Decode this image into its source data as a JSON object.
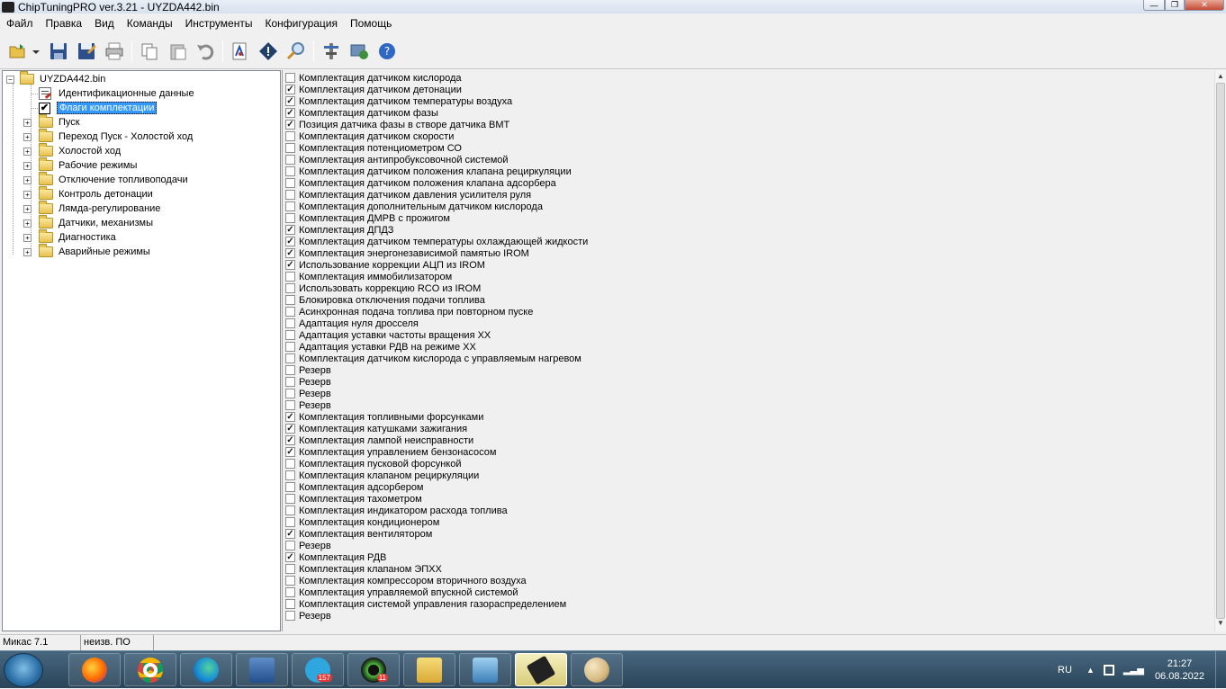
{
  "window": {
    "title": "ChipTuningPRO ver.3.21 - UYZDA442.bin",
    "controls": {
      "minimize": "—",
      "maximize": "❐",
      "close": "✕"
    }
  },
  "menu": [
    "Файл",
    "Правка",
    "Вид",
    "Команды",
    "Инструменты",
    "Конфигурация",
    "Помощь"
  ],
  "toolbar": [
    "open-icon",
    "dropdown-arrow-icon",
    "save-icon",
    "save-as-icon",
    "print-icon",
    "copy-icon",
    "paste-icon",
    "undo-icon",
    "compare-icon",
    "diamond-info-icon",
    "search-icon",
    "tools-icon",
    "checksum-icon",
    "help-icon"
  ],
  "tree": {
    "root": "UYZDA442.bin",
    "children": [
      {
        "label": "Идентификационные данные",
        "icon": "doc-icon",
        "expandable": false,
        "selected": false
      },
      {
        "label": "Флаги комплектации",
        "icon": "checkbox-icon",
        "expandable": false,
        "selected": true
      },
      {
        "label": "Пуск",
        "icon": "folder-icon",
        "expandable": true
      },
      {
        "label": "Переход Пуск - Холостой ход",
        "icon": "folder-icon",
        "expandable": true
      },
      {
        "label": "Холостой ход",
        "icon": "folder-icon",
        "expandable": true
      },
      {
        "label": "Рабочие режимы",
        "icon": "folder-icon",
        "expandable": true
      },
      {
        "label": "Отключение топливоподачи",
        "icon": "folder-icon",
        "expandable": true
      },
      {
        "label": "Контроль детонации",
        "icon": "folder-icon",
        "expandable": true
      },
      {
        "label": "Лямда-регулирование",
        "icon": "folder-icon",
        "expandable": true
      },
      {
        "label": "Датчики, механизмы",
        "icon": "folder-icon",
        "expandable": true
      },
      {
        "label": "Диагностика",
        "icon": "folder-icon",
        "expandable": true
      },
      {
        "label": "Аварийные режимы",
        "icon": "folder-icon",
        "expandable": true
      }
    ]
  },
  "flags": [
    {
      "label": "Комплектация датчиком кислорода",
      "checked": false
    },
    {
      "label": "Комплектация датчиком детонации",
      "checked": true
    },
    {
      "label": "Комплектация датчиком температуры воздуха",
      "checked": true
    },
    {
      "label": "Комплектация датчиком фазы",
      "checked": true
    },
    {
      "label": "Позиция датчика фазы в створе датчика ВМТ",
      "checked": true
    },
    {
      "label": "Комплектация датчиком скорости",
      "checked": false
    },
    {
      "label": "Комплектация потенциометром СО",
      "checked": false
    },
    {
      "label": "Комплектация антипробуксовочной системой",
      "checked": false
    },
    {
      "label": "Комплектация датчиком положения клапана рециркуляции",
      "checked": false
    },
    {
      "label": "Комплектация датчиком положения клапана адсорбера",
      "checked": false
    },
    {
      "label": "Комплектация датчиком давления усилителя руля",
      "checked": false
    },
    {
      "label": "Комплектация дополнительным датчиком кислорода",
      "checked": false
    },
    {
      "label": "Комплектация ДМРВ с прожигом",
      "checked": false
    },
    {
      "label": "Комплектация ДПДЗ",
      "checked": true
    },
    {
      "label": "Комплектация датчиком температуры охлаждающей жидкости",
      "checked": true
    },
    {
      "label": "Комплектация энергонезависимой памятью IROM",
      "checked": true
    },
    {
      "label": "Использование коррекции АЦП из IROM",
      "checked": true
    },
    {
      "label": "Комплектация иммобилизатором",
      "checked": false
    },
    {
      "label": "Использовать коррекцию RCO из IROM",
      "checked": false
    },
    {
      "label": "Блокировка отключения подачи топлива",
      "checked": false
    },
    {
      "label": "Асинхронная подача топлива при повторном пуске",
      "checked": false
    },
    {
      "label": "Адаптация нуля дросселя",
      "checked": false
    },
    {
      "label": "Адаптация уставки частоты вращения ХХ",
      "checked": false
    },
    {
      "label": "Адаптация уставки РДВ на режиме ХХ",
      "checked": false
    },
    {
      "label": "Комплектация датчиком кислорода с управляемым нагревом",
      "checked": false
    },
    {
      "label": "Резерв",
      "checked": false
    },
    {
      "label": "Резерв",
      "checked": false
    },
    {
      "label": "Резерв",
      "checked": false
    },
    {
      "label": "Резерв",
      "checked": false
    },
    {
      "label": "Комплектация топливными форсунками",
      "checked": true
    },
    {
      "label": "Комплектация катушками зажигания",
      "checked": true
    },
    {
      "label": "Комплектация лампой неисправности",
      "checked": true
    },
    {
      "label": "Комплектация управлением бензонасосом",
      "checked": true
    },
    {
      "label": "Комплектация пусковой форсункой",
      "checked": false
    },
    {
      "label": "Комплектация клапаном рециркуляции",
      "checked": false
    },
    {
      "label": "Комплектация адсорбером",
      "checked": false
    },
    {
      "label": "Комплектация тахометром",
      "checked": false
    },
    {
      "label": "Комплектация индикатором расхода топлива",
      "checked": false
    },
    {
      "label": "Комплектация кондиционером",
      "checked": false
    },
    {
      "label": "Комплектация вентилятором",
      "checked": true
    },
    {
      "label": "Резерв",
      "checked": false
    },
    {
      "label": "Комплектация РДВ",
      "checked": true
    },
    {
      "label": "Комплектация клапаном ЭПХХ",
      "checked": false
    },
    {
      "label": "Комплектация компрессором вторичного воздуха",
      "checked": false
    },
    {
      "label": "Комплектация управляемой впускной системой",
      "checked": false
    },
    {
      "label": "Комплектация системой управления газораспределением",
      "checked": false
    },
    {
      "label": "Резерв",
      "checked": false
    }
  ],
  "status": {
    "ecu": "Микас 7.1",
    "software": "неизв. ПО"
  },
  "taskbar": {
    "apps": [
      "firefox-icon",
      "chrome-icon",
      "edge-icon",
      "remote-desktop-icon",
      "telegram-icon",
      "game-icon",
      "file-explorer-icon",
      "photo-viewer-icon",
      "chiptuning-icon",
      "paint-icon"
    ],
    "badges": {
      "telegram": "157",
      "game": "11"
    },
    "lang": "RU",
    "time": "21:27",
    "date": "06.08.2022"
  },
  "colors": {
    "selection": "#3399ff",
    "taskbar": "#2a4459"
  }
}
